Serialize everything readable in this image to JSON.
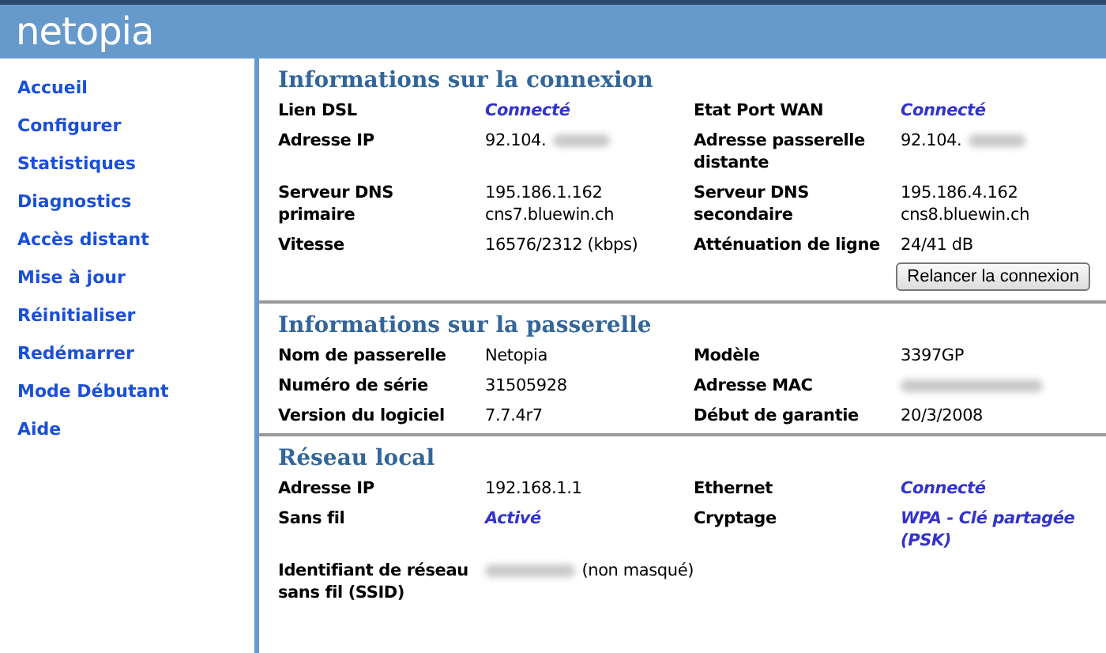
{
  "header": {
    "logo": "netopia"
  },
  "sidebar": {
    "items": [
      {
        "label": "Accueil"
      },
      {
        "label": "Configurer"
      },
      {
        "label": "Statistiques"
      },
      {
        "label": "Diagnostics"
      },
      {
        "label": "Accès distant"
      },
      {
        "label": "Mise à jour"
      },
      {
        "label": "Réinitialiser"
      },
      {
        "label": "Redémarrer"
      },
      {
        "label": "Mode Débutant"
      },
      {
        "label": "Aide"
      }
    ]
  },
  "sections": [
    {
      "title": "Informations sur la connexion",
      "rows": [
        [
          {
            "label": "Lien DSL",
            "value": "Connecté",
            "kind": "status"
          },
          {
            "label": "Etat Port WAN",
            "value": "Connecté",
            "kind": "status"
          }
        ],
        [
          {
            "label": "Adresse IP",
            "value": "92.104.",
            "kind": "plain",
            "redacted": true
          },
          {
            "label": "Adresse passerelle distante",
            "value": "92.104.",
            "kind": "plain",
            "redacted": true
          }
        ],
        [
          {
            "label": "Serveur DNS primaire",
            "value": "195.186.1.162\ncns7.bluewin.ch",
            "kind": "plain"
          },
          {
            "label": "Serveur DNS secondaire",
            "value": "195.186.4.162\ncns8.bluewin.ch",
            "kind": "plain"
          }
        ],
        [
          {
            "label": "Vitesse",
            "value": "16576/2312 (kbps)",
            "kind": "plain"
          },
          {
            "label": "Atténuation de ligne",
            "value": "24/41 dB",
            "kind": "plain"
          }
        ]
      ],
      "button": "Relancer la connexion"
    },
    {
      "title": "Informations sur la passerelle",
      "rows": [
        [
          {
            "label": "Nom de passerelle",
            "value": "Netopia",
            "kind": "plain"
          },
          {
            "label": "Modèle",
            "value": "3397GP",
            "kind": "plain"
          }
        ],
        [
          {
            "label": "Numéro de série",
            "value": "31505928",
            "kind": "plain"
          },
          {
            "label": "Adresse MAC",
            "kind": "plain",
            "redacted": true
          }
        ],
        [
          {
            "label": "Version du logiciel",
            "value": "7.7.4r7",
            "kind": "plain"
          },
          {
            "label": "Début de garantie",
            "value": "20/3/2008",
            "kind": "plain"
          }
        ]
      ]
    },
    {
      "title": "Réseau local",
      "rows": [
        [
          {
            "label": "Adresse IP",
            "value": "192.168.1.1",
            "kind": "plain"
          },
          {
            "label": "Ethernet",
            "value": "Connecté",
            "kind": "status"
          }
        ],
        [
          {
            "label": "Sans fil",
            "value": "Activé",
            "kind": "status"
          },
          {
            "label": "Cryptage",
            "value": "WPA - Clé partagée (PSK)",
            "kind": "status"
          }
        ],
        [
          {
            "label": "Identifiant de réseau sans fil (SSID)",
            "value": "(non masqué)",
            "kind": "plain",
            "redacted_before": true
          }
        ]
      ]
    }
  ]
}
